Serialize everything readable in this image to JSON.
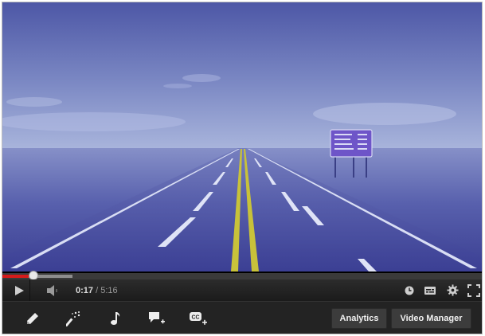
{
  "player": {
    "current_time": "0:17",
    "separator": " / ",
    "duration": "5:16",
    "played_fraction": 0.054,
    "buffered_fraction": 0.145
  },
  "toolbar": {
    "analytics_label": "Analytics",
    "video_manager_label": "Video Manager"
  },
  "icons": {
    "play": "play-icon",
    "volume": "volume-icon",
    "watch_later": "clock-icon",
    "captions": "captions-icon",
    "settings": "gear-icon",
    "fullscreen": "fullscreen-icon",
    "edit": "pencil-icon",
    "enhance": "magic-wand-icon",
    "audio": "music-note-icon",
    "annotations": "annotation-add-icon",
    "cc": "cc-add-icon"
  },
  "colors": {
    "progress_played": "#d41b1b",
    "control_bar": "#1b1b1b",
    "toolbar_bg": "#232323",
    "button_bg": "#3c3c3c"
  }
}
